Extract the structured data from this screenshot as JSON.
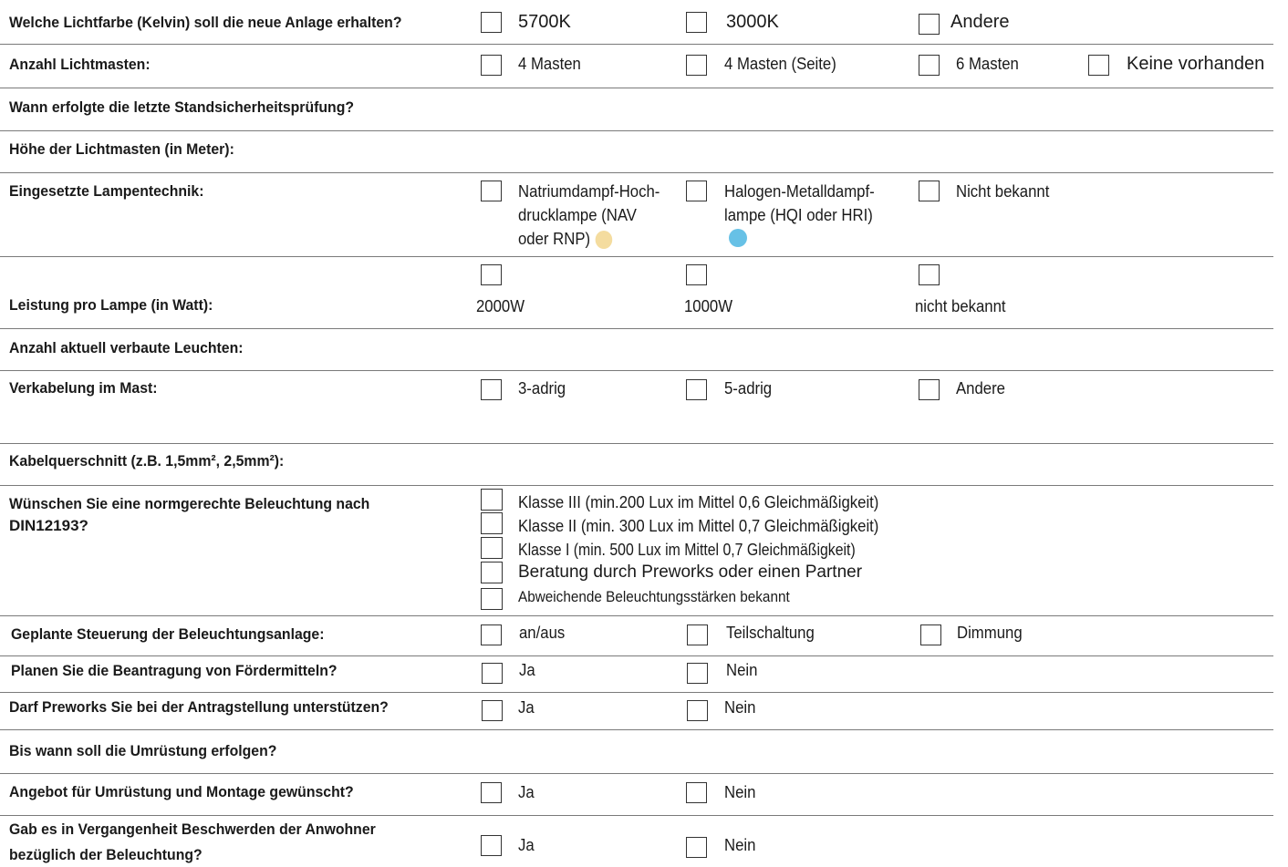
{
  "colors": {
    "sodium_dot": "#f4dc9f",
    "halogen_dot": "#67c1e6"
  },
  "rows": {
    "r1": {
      "q": "Welche Lichtfarbe (Kelvin) soll die neue Anlage erhalten?",
      "o1": "5700K",
      "o2": "3000K",
      "o3": "Andere"
    },
    "r2": {
      "q": "Anzahl Lichtmasten:",
      "o1": "4 Masten",
      "o2": "4 Masten (Seite)",
      "o3": "6 Masten",
      "o4": "Keine vorhanden"
    },
    "r3": {
      "q": "Wann erfolgte die letzte Standsicherheitsprüfung?"
    },
    "r4": {
      "q": "Höhe der Lichtmasten (in Meter):"
    },
    "r5": {
      "q": "Eingesetzte Lampentechnik:",
      "o1": [
        "Natriumdampf-Hoch-",
        "drucklampe (NAV",
        "oder RNP)"
      ],
      "o2": [
        "Halogen-Metalldampf-",
        "lampe (HQI oder HRI)"
      ],
      "o3": "Nicht bekannt"
    },
    "r6": {
      "q": "Leistung pro Lampe (in Watt):",
      "o1": "2000W",
      "o2": "1000W",
      "o3": "nicht bekannt"
    },
    "r7": {
      "q": "Anzahl aktuell verbaute Leuchten:"
    },
    "r8": {
      "q": "Verkabelung im Mast:",
      "o1": "3-adrig",
      "o2": "5-adrig",
      "o3": "Andere"
    },
    "r9": {
      "q": "Kabelquerschnitt (z.B. 1,5mm², 2,5mm²):"
    },
    "r10": {
      "q1": "Wünschen Sie eine normgerechte Beleuchtung nach",
      "q2": "DIN12193?",
      "o": [
        "Klasse III (min.200 Lux im Mittel 0,6 Gleichmäßigkeit)",
        "Klasse II (min. 300 Lux im Mittel 0,7 Gleichmäßigkeit)",
        "Klasse I (min. 500 Lux im Mittel 0,7 Gleichmäßigkeit)",
        "Beratung durch Preworks oder einen Partner",
        "Abweichende Beleuchtungsstärken bekannt"
      ]
    },
    "r11": {
      "q": "Geplante Steuerung der Beleuchtungsanlage:",
      "o1": "an/aus",
      "o2": "Teilschaltung",
      "o3": "Dimmung"
    },
    "r12": {
      "q": "Planen Sie die Beantragung von Fördermitteln?",
      "o1": "Ja",
      "o2": "Nein"
    },
    "r13": {
      "q": "Darf Preworks Sie bei der Antragstellung unterstützen?",
      "o1": "Ja",
      "o2": "Nein"
    },
    "r14": {
      "q": "Bis wann soll die Umrüstung erfolgen?"
    },
    "r15": {
      "q": "Angebot für Umrüstung und Montage gewünscht?",
      "o1": "Ja",
      "o2": "Nein"
    },
    "r16": {
      "q1": "Gab es in Vergangenheit Beschwerden der Anwohner",
      "q2": "bezüglich der Beleuchtung?",
      "o1": "Ja",
      "o2": "Nein"
    }
  }
}
